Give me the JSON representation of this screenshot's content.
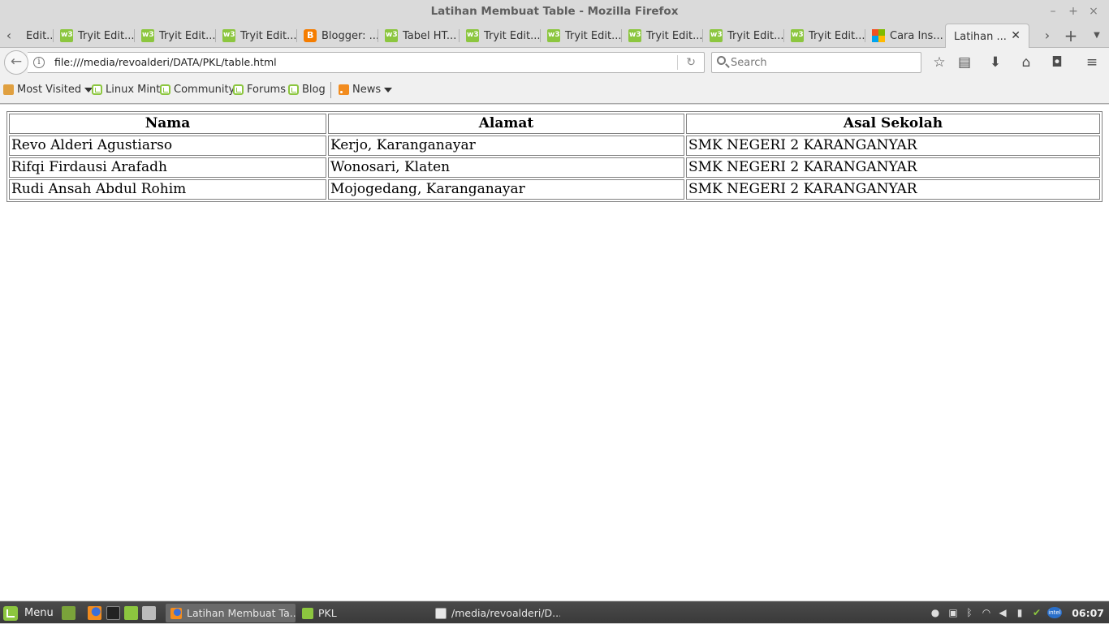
{
  "window": {
    "title": "Latihan Membuat Table - Mozilla Firefox"
  },
  "tabs": [
    {
      "label": "Edit...",
      "icon": "w3-icon"
    },
    {
      "label": "Tryit Edit...",
      "icon": "w3-icon"
    },
    {
      "label": "Tryit Edit...",
      "icon": "w3-icon"
    },
    {
      "label": "Tryit Edit...",
      "icon": "w3-icon"
    },
    {
      "label": "Blogger: ...",
      "icon": "blogger-icon"
    },
    {
      "label": "Tabel HT...",
      "icon": "w3-icon"
    },
    {
      "label": "Tryit Edit...",
      "icon": "w3-icon"
    },
    {
      "label": "Tryit Edit...",
      "icon": "w3-icon"
    },
    {
      "label": "Tryit Edit...",
      "icon": "w3-icon"
    },
    {
      "label": "Tryit Edit...",
      "icon": "w3-icon"
    },
    {
      "label": "Tryit Edit...",
      "icon": "w3-icon"
    },
    {
      "label": "Cara Ins...",
      "icon": "microsoft-icon"
    },
    {
      "label": "Latihan ...",
      "icon": "none",
      "active": true
    }
  ],
  "navbar": {
    "url": "file:///media/revoalderi/DATA/PKL/table.html",
    "search_placeholder": "Search"
  },
  "bookmarks": {
    "most_visited": "Most Visited",
    "items": [
      "Linux Mint",
      "Community",
      "Forums",
      "Blog"
    ],
    "news": "News"
  },
  "table": {
    "headers": [
      "Nama",
      "Alamat",
      "Asal Sekolah"
    ],
    "rows": [
      [
        "Revo Alderi Agustiarso",
        "Kerjo, Karanganayar",
        "SMK NEGERI 2 KARANGANYAR"
      ],
      [
        "Rifqi Firdausi Arafadh",
        "Wonosari, Klaten",
        "SMK NEGERI 2 KARANGANYAR"
      ],
      [
        "Rudi Ansah Abdul Rohim",
        "Mojogedang, Karanganayar",
        "SMK NEGERI 2 KARANGANYAR"
      ]
    ]
  },
  "taskbar": {
    "menu_label": "Menu",
    "tasks": [
      {
        "label": "Latihan Membuat Ta...",
        "icon": "firefox-icon",
        "active": true
      },
      {
        "label": "PKL",
        "icon": "folder-icon",
        "active": false
      },
      {
        "label": "/media/revoalderi/D...",
        "icon": "text-editor-icon",
        "active": false
      }
    ],
    "clock": "06:07"
  },
  "colors": {
    "mint_green": "#8cc63f",
    "chrome_bg": "#f0f0f0",
    "taskbar_bg": "#3f3f3f"
  }
}
